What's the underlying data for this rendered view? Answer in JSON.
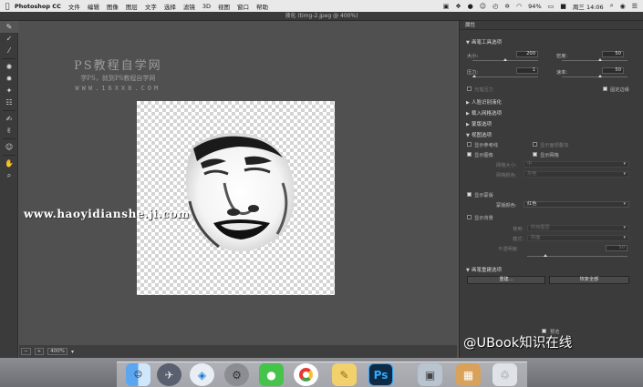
{
  "menubar": {
    "app_name": "Photoshop CC",
    "menus": [
      "文件",
      "编辑",
      "图像",
      "图层",
      "文字",
      "选择",
      "滤镜",
      "3D",
      "视图",
      "窗口",
      "帮助"
    ],
    "battery": "94%",
    "clock": "周三 14:06"
  },
  "window": {
    "title": "液化 (timg-2.jpeg @ 400%)"
  },
  "canvas": {
    "watermark_title": "PS教程自学网",
    "watermark_subtitle": "学PS，就到PS教程自学网",
    "watermark_url": "WWW.16XX8.COM",
    "site_watermark": "www.haoyidianshe.ji.com"
  },
  "status": {
    "zoom": "400%"
  },
  "panel": {
    "tab": "属性",
    "brush_options": "画笔工具选项",
    "size_label": "大小:",
    "size_value": "200",
    "density_label": "密度:",
    "density_value": "50",
    "pressure_label": "压力:",
    "pressure_value": "1",
    "rate_label": "速率:",
    "rate_value": "50",
    "stylus_pressure": "光笔压力",
    "pin_edges": "固定边缘",
    "face_liquify": "人脸识别液化",
    "load_mesh": "载入网格选项",
    "mask_options": "蒙版选项",
    "view_options": "视图选项",
    "show_guides": "显示参考线",
    "show_face_overlay": "显示面部叠加",
    "show_image": "显示图像",
    "show_mesh": "显示网格",
    "mesh_size_label": "网格大小:",
    "mesh_size_value": "中",
    "mesh_color_label": "网格颜色:",
    "mesh_color_value": "灰色",
    "show_mask": "显示蒙版",
    "mask_color_label": "蒙版颜色:",
    "mask_color_value": "红色",
    "show_backdrop": "显示背景",
    "use_label": "使用:",
    "use_value": "所有图层",
    "mode_label": "模式:",
    "mode_value": "前面",
    "opacity_label": "不透明度:",
    "opacity_value": "50",
    "brush_rebuild": "画笔重建选项",
    "rebuild_button": "重建...",
    "restore_all_button": "恢复全部",
    "preview": "预览"
  },
  "watermark_brand": "@UBook知识在线",
  "colors": {
    "accent": "#1e73c8",
    "panel": "#3b3b3b",
    "canvas": "#505050"
  },
  "dock_icons": [
    "finder-icon",
    "launchpad-icon",
    "safari-icon",
    "system-preferences-icon",
    "wechat-icon",
    "chrome-icon",
    "notes-icon",
    "photoshop-icon",
    "preview-icon",
    "photos-icon",
    "trash-icon"
  ]
}
